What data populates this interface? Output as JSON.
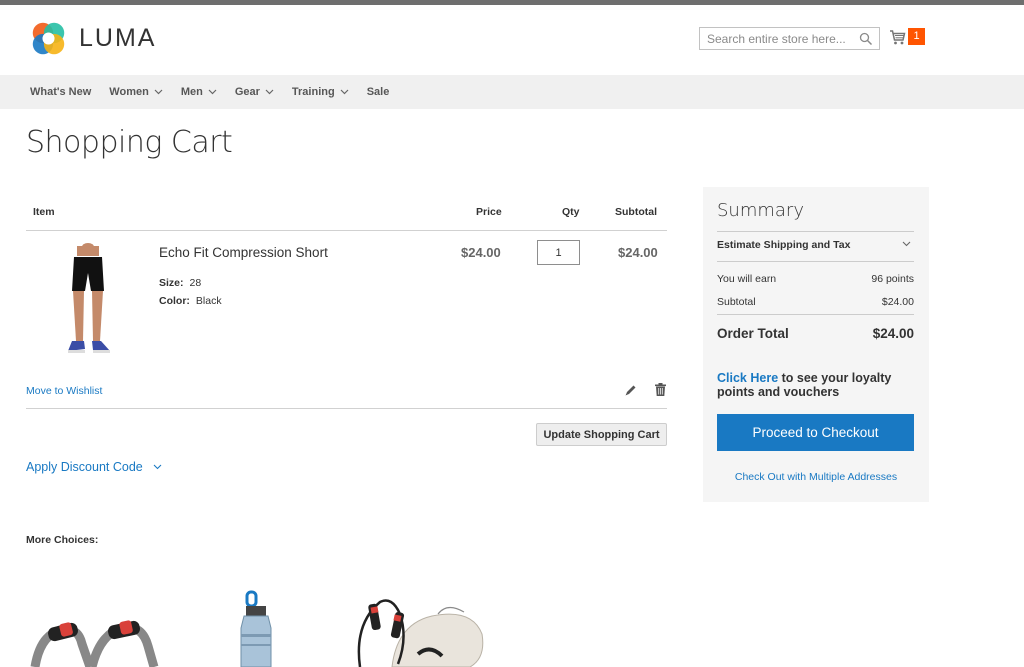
{
  "header": {
    "logo_text": "LUMA",
    "search": {
      "placeholder": "Search entire store here..."
    },
    "cart_count": "1"
  },
  "nav": {
    "items": [
      {
        "label": "What's New",
        "has_dropdown": false
      },
      {
        "label": "Women",
        "has_dropdown": true
      },
      {
        "label": "Men",
        "has_dropdown": true
      },
      {
        "label": "Gear",
        "has_dropdown": true
      },
      {
        "label": "Training",
        "has_dropdown": true
      },
      {
        "label": "Sale",
        "has_dropdown": false
      }
    ]
  },
  "page": {
    "title": "Shopping Cart"
  },
  "cart": {
    "headers": {
      "item": "Item",
      "price": "Price",
      "qty": "Qty",
      "subtotal": "Subtotal"
    },
    "items": [
      {
        "name": "Echo Fit Compression Short",
        "options": [
          {
            "label": "Size:",
            "value": "28"
          },
          {
            "label": "Color:",
            "value": "Black"
          }
        ],
        "price": "$24.00",
        "qty": "1",
        "subtotal": "$24.00",
        "wishlist_label": "Move to Wishlist"
      }
    ],
    "update_label": "Update Shopping Cart",
    "discount_label": "Apply Discount Code"
  },
  "more_choices": {
    "title": "More Choices:"
  },
  "summary": {
    "title": "Summary",
    "estimate_label": "Estimate Shipping and Tax",
    "earn_label": "You will earn",
    "earn_value": "96 points",
    "subtotal_label": "Subtotal",
    "subtotal_value": "$24.00",
    "order_total_label": "Order Total",
    "order_total_value": "$24.00",
    "loyalty_link": "Click Here",
    "loyalty_text": " to see your loyalty points and vouchers",
    "checkout_label": "Proceed to Checkout",
    "multi_label": "Check Out with Multiple Addresses"
  },
  "colors": {
    "accent_blue": "#1979c3",
    "cart_badge": "#ff5501",
    "nav_bg": "#f0f0f0",
    "summary_bg": "#f5f5f5"
  },
  "icons": [
    "search-icon",
    "cart-icon",
    "chevron-down-icon",
    "edit-icon",
    "trash-icon"
  ]
}
